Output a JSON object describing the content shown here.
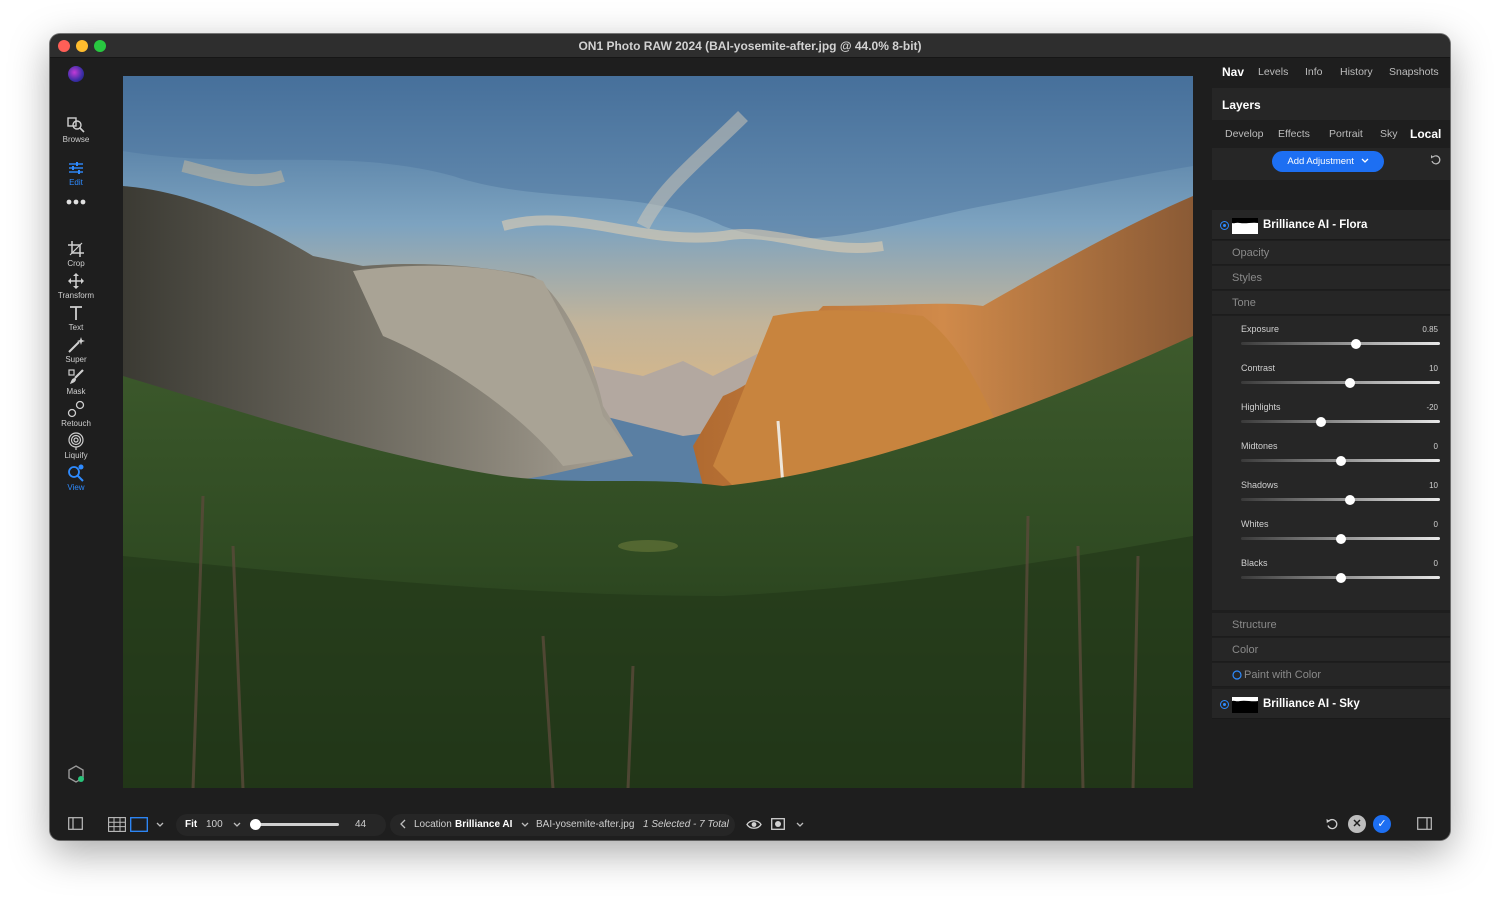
{
  "window": {
    "title": "ON1 Photo RAW 2024 (BAI-yosemite-after.jpg @ 44.0% 8-bit)"
  },
  "left_toolbar": {
    "tools": [
      {
        "label": "Browse",
        "icon": "browse-icon",
        "active": false
      },
      {
        "label": "Edit",
        "icon": "sliders-icon",
        "active": true
      },
      {
        "label": "Crop",
        "icon": "crop-icon",
        "active": false
      },
      {
        "label": "Transform",
        "icon": "move-icon",
        "active": false
      },
      {
        "label": "Text",
        "icon": "text-icon",
        "active": false
      },
      {
        "label": "Super",
        "icon": "magic-wand-icon",
        "active": false
      },
      {
        "label": "Mask",
        "icon": "mask-brush-icon",
        "active": false
      },
      {
        "label": "Retouch",
        "icon": "retouch-icon",
        "active": false
      },
      {
        "label": "Liquify",
        "icon": "liquify-icon",
        "active": false
      },
      {
        "label": "View",
        "icon": "magnifier-icon",
        "active": true
      }
    ]
  },
  "right_panel": {
    "tabs": [
      "Nav",
      "Levels",
      "Info",
      "History",
      "Snapshots"
    ],
    "active_tab": "Nav",
    "layers_title": "Layers",
    "subtabs": [
      "Develop",
      "Effects",
      "Portrait",
      "Sky",
      "Local"
    ],
    "active_subtab": "Local",
    "add_adjustment_label": "Add Adjustment",
    "layers": [
      {
        "name": "Brilliance AI - Flora",
        "selected": true
      },
      {
        "name": "Brilliance AI - Sky",
        "selected": false
      }
    ],
    "sections": {
      "opacity": "Opacity",
      "styles": "Styles",
      "tone": "Tone",
      "structure": "Structure",
      "color": "Color",
      "paint_with_color": "Paint with Color"
    },
    "sliders": [
      {
        "label": "Exposure",
        "value": "0.85",
        "fraction": 0.58
      },
      {
        "label": "Contrast",
        "value": "10",
        "fraction": 0.55
      },
      {
        "label": "Highlights",
        "value": "-20",
        "fraction": 0.4
      },
      {
        "label": "Midtones",
        "value": "0",
        "fraction": 0.5
      },
      {
        "label": "Shadows",
        "value": "10",
        "fraction": 0.55
      },
      {
        "label": "Whites",
        "value": "0",
        "fraction": 0.5
      },
      {
        "label": "Blacks",
        "value": "0",
        "fraction": 0.5
      }
    ]
  },
  "bottom_bar": {
    "fit_label": "Fit",
    "zoom_value": "100",
    "slider_value": "44",
    "slider_fraction": 0.0,
    "location_label": "Location",
    "location_value": "Brilliance AI",
    "filename": "BAI-yosemite-after.jpg",
    "selection_status": "1 Selected - 7 Total"
  },
  "colors": {
    "accent": "#1d6ff2",
    "panel_bg": "#262626",
    "window_bg": "#1e1e1e"
  }
}
